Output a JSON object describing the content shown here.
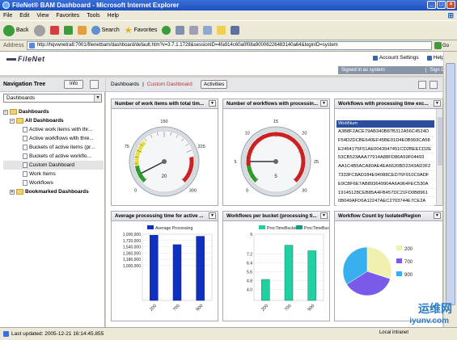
{
  "window": {
    "title": "FileNet® BAM Dashboard - Microsoft Internet Explorer"
  },
  "menu": [
    "File",
    "Edit",
    "View",
    "Favorites",
    "Tools",
    "Help"
  ],
  "toolbar": {
    "back": "Back",
    "search": "Search",
    "favorites": "Favorites"
  },
  "address": {
    "label": "Address",
    "url": "http://hqvwnetra8:7001/filenetbam/dashboard/default.htm?v=3.7.1.1728&sessionID=4fa914c60a0f08a90006226483140a64&loginID=system",
    "go": "Go"
  },
  "app": {
    "logo": "FileNet",
    "account_settings": "Account Settings",
    "help": "Help",
    "signed_in": "Signed in as system",
    "sign_out": "Sign Out"
  },
  "nav": {
    "title": "Navigation Tree",
    "info": "Info",
    "select": "Dashboards",
    "tree": [
      {
        "label": "Dashboards",
        "level": 0,
        "type": "folder",
        "bold": true
      },
      {
        "label": "All Dashboards",
        "level": 1,
        "type": "folder",
        "bold": true
      },
      {
        "label": "Active work items with thr...",
        "level": 2,
        "type": "doc"
      },
      {
        "label": "Active workflows with thre...",
        "level": 2,
        "type": "doc"
      },
      {
        "label": "Buckets of active items (pr...",
        "level": 2,
        "type": "doc"
      },
      {
        "label": "Buckets of active workflo...",
        "level": 2,
        "type": "doc"
      },
      {
        "label": "Custom Dashboard",
        "level": 2,
        "type": "doc",
        "selected": true
      },
      {
        "label": "Work Items",
        "level": 2,
        "type": "doc"
      },
      {
        "label": "Workflows",
        "level": 2,
        "type": "doc"
      },
      {
        "label": "Bookmarked Dashboards",
        "level": 1,
        "type": "folder",
        "bold": true
      }
    ]
  },
  "main": {
    "breadcrumb_root": "Dashboards",
    "breadcrumb_sep": "|",
    "breadcrumb_current": "Custom Dashboard",
    "activities": "Activities"
  },
  "panels": {
    "p1": {
      "title": "Number of work items with total tim..."
    },
    "p2": {
      "title": "Number of workflows with processin..."
    },
    "p3": {
      "title": "Workflows with processing time exc..."
    },
    "p4": {
      "title": "Average processing time for active ..."
    },
    "p5": {
      "title": "Workflows per bucket (processing ti..."
    },
    "p6": {
      "title": "Workflow Count by IsolatedRegion"
    }
  },
  "workflow_list": {
    "header": "WobNum",
    "rows": [
      "A3B8F2ACE79AB340B87B312A56C4524D",
      "F54D2DCBE640EF45BE01D4E0B993CA58",
      "E2454175F51AE0043947451CD2BEECD2E",
      "53CB523AAA77914A88FD86A59F04493",
      "AA1C4B5ACA80AE4EA6620BD2343AD3F2",
      "7333FC8AD184E94088CED76F910C9ADF",
      "E9CBF6E7AB893649904A6A964FEC530A",
      "19145128CEB85A4FB457DC21FD0B8961",
      "0B049AFD6A12247AEC2703744E7CE2A"
    ]
  },
  "chart_data": [
    {
      "type": "gauge",
      "scale": [
        0,
        300
      ],
      "ticks": [
        0,
        75,
        150,
        225,
        300
      ],
      "value": 20,
      "zones": [
        {
          "from": 0,
          "to": 40,
          "color": "#2aa02a"
        },
        {
          "from": 40,
          "to": 100,
          "color": "#e8e040"
        },
        {
          "from": 240,
          "to": 300,
          "color": "#d02020"
        }
      ]
    },
    {
      "type": "gauge",
      "scale": [
        0,
        30
      ],
      "ticks": [
        0,
        5,
        10,
        15,
        20,
        25,
        30
      ],
      "value": 5,
      "zones": [
        {
          "from": 0,
          "to": 4,
          "color": "#2aa02a"
        },
        {
          "from": 4,
          "to": 30,
          "color": "#d02020"
        }
      ]
    },
    {
      "type": "bar",
      "categories": [
        "200",
        "700",
        "900"
      ],
      "series": [
        {
          "name": "Average Processing",
          "values": [
            1870000,
            1600000,
            1840000
          ]
        }
      ],
      "ylim": [
        0,
        1900000
      ],
      "yticks": [
        "1,900,000",
        "1,720,000",
        "1,540,000",
        "1,360,000",
        "1,180,000",
        "1,000,000"
      ],
      "ytick_values": [
        1900000,
        1720000,
        1540000,
        1360000,
        1180000,
        1000000
      ]
    },
    {
      "type": "bar",
      "categories": [
        "200",
        "700",
        "900"
      ],
      "series": [
        {
          "name": "ProcTimeBucket1",
          "values": [
            4.9,
            8.0,
            7.5
          ]
        },
        {
          "name": "ProcTimeBucket2",
          "values": [
            0,
            0,
            0
          ]
        }
      ],
      "ylim": [
        3,
        9
      ],
      "yticks": [
        "9",
        "7.2",
        "6.4",
        "5.6",
        "4.8",
        "4.0"
      ],
      "ytick_values": [
        9.0,
        7.2,
        6.4,
        5.6,
        4.8,
        4.0
      ]
    },
    {
      "type": "pie",
      "labels": [
        "200",
        "700",
        "900"
      ],
      "values": [
        30,
        36,
        34
      ],
      "colors": [
        "#f0f0b0",
        "#7a5ae8",
        "#38b0f0"
      ]
    }
  ]
}
